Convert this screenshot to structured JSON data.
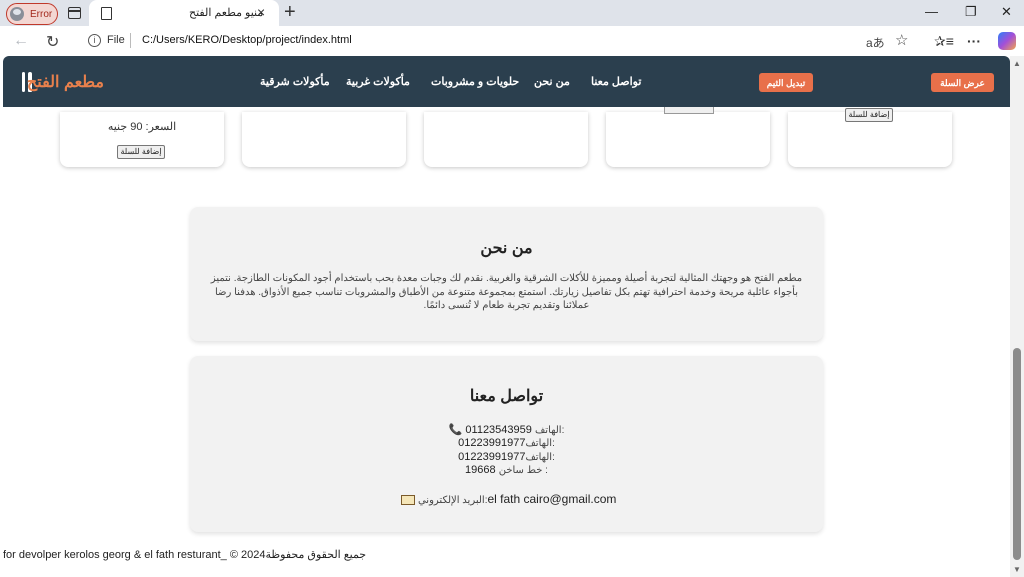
{
  "browser": {
    "profile_status": "Error",
    "tab_title": "منيو مطعم الفتح",
    "tab_close": "×",
    "new_tab": "+",
    "file_label": "File",
    "url": "C:/Users/KERO/Desktop/project/index.html",
    "read_aloud": "aあ",
    "favorite": "☆",
    "favorites_bar": "✰≡",
    "more": "···",
    "minimize": "—",
    "restore": "❐",
    "close": "✕",
    "back": "←",
    "reload": "↻"
  },
  "header": {
    "brand": "مطعم الفتح",
    "nav": [
      "تواصل معنا",
      "من نحن",
      "حلويات و مشروبات",
      "مأكولات غربية",
      "مأكولات شرقية"
    ],
    "theme_button": "تبديل الثيم",
    "cart_button": "عرض السلة"
  },
  "cards": [
    {
      "price_label": "السعر:",
      "price_value": "90",
      "currency": "جنيه",
      "add_button": "إضافة للسلة"
    }
  ],
  "card_partial_button": "إضافة للسلة",
  "about": {
    "title": "من نحن",
    "text": "مطعم الفتح هو وجهتك المثالية لتجربة أصيلة ومميزة للأكلات الشرقية والغربية. نقدم لك وجبات معدة بحب باستخدام أجود المكونات الطازجة. نتميز بأجواء عائلية مريحة وخدمة احترافية تهتم بكل تفاصيل زيارتك. استمتع بمجموعة متنوعة من الأطباق والمشروبات تناسب جميع الأذواق. هدفنا رضا عملائنا وتقديم تجربة طعام لا تُنسى دائمًا."
  },
  "contact": {
    "title": "تواصل معنا",
    "phone_label": "الهاتف:",
    "phones": [
      "01123543959",
      "01223991977",
      "01223991977"
    ],
    "hotline_label": "خط ساخن :",
    "hotline": "19668",
    "email_label": "البريد الإلكتروني:",
    "email": "el fath cairo@gmail.com"
  },
  "footer": {
    "text": "for devolper kerolos georg & el fath resturant_ © 2024جميع الحقوق محفوظة"
  },
  "colors": {
    "header_bg": "#2b3f4e",
    "accent": "#e8704a",
    "brand": "#e8804c"
  }
}
